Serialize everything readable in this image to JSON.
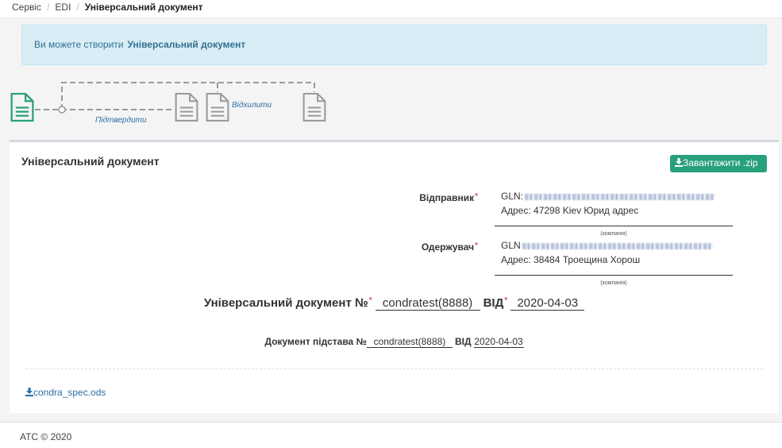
{
  "breadcrumb": [
    "Сервіс",
    "EDI",
    "Універсальний документ"
  ],
  "alert": {
    "text": "Ви можете створити",
    "link": "Універсальний документ"
  },
  "workflow": {
    "confirm_label": "Підтвердити",
    "reject_label": "Відхилити",
    "active_color": "#27a07b",
    "inactive_color": "#9a9a9a"
  },
  "panel": {
    "title": "Універсальний документ",
    "download_label": "Завантажити .zip",
    "download_icon": "download-icon"
  },
  "sender": {
    "label": "Відправник",
    "gln_label": "GLN:",
    "address": "Адрес: 47298 Kiev Юрид адрес",
    "caption": "(компанія)"
  },
  "receiver": {
    "label": "Одержувач",
    "gln_label": "GLN",
    "address": "Адрес: 38484 Троещина Хорош",
    "caption": "(компанія)"
  },
  "document": {
    "title": "Універсальний документ №",
    "number": "condratest(8888)",
    "from_label": "ВІД",
    "date": "2020-04-03"
  },
  "basis": {
    "title": "Документ підстава №",
    "number": "condratest(8888)",
    "from_label": "ВІД",
    "date": "2020-04-03"
  },
  "attachment": {
    "filename": "condra_spec.ods"
  },
  "footer": {
    "text": "АТС © 2020"
  }
}
